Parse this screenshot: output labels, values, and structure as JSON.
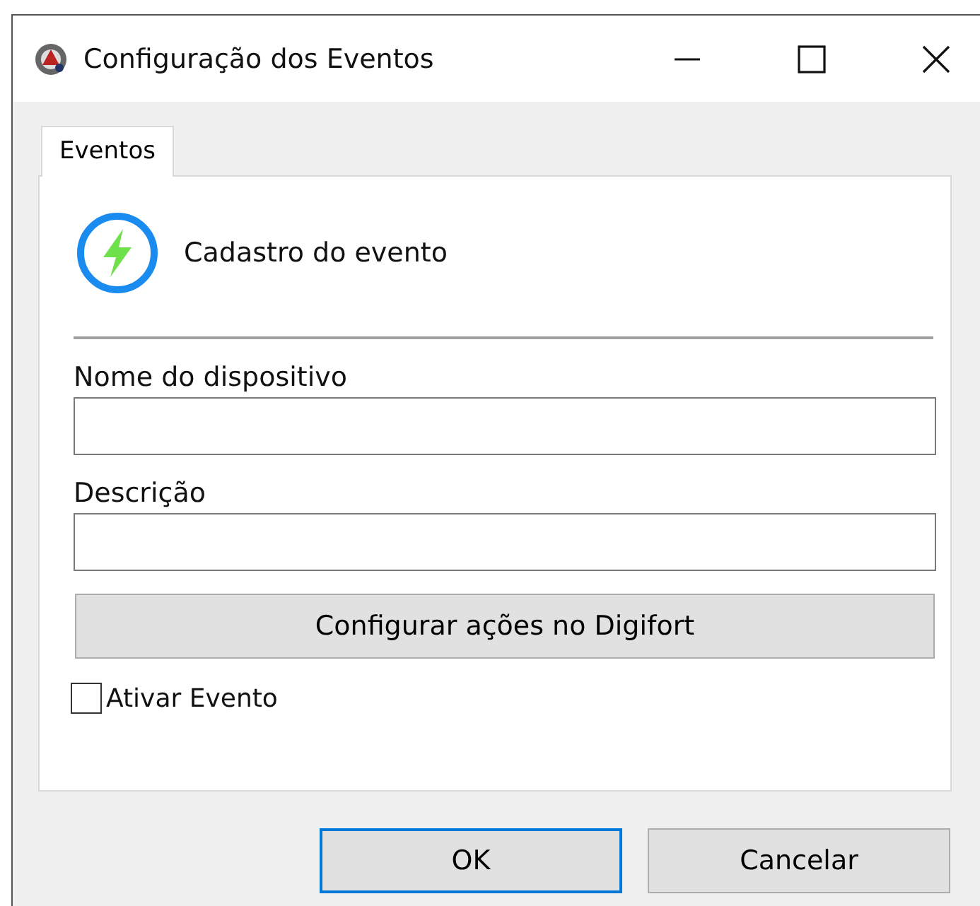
{
  "window": {
    "title": "Configuração dos Eventos"
  },
  "tabs": [
    {
      "label": "Eventos",
      "selected": true
    }
  ],
  "header": {
    "title": "Cadastro do evento"
  },
  "fields": [
    {
      "label": "Nome do dispositivo"
    },
    {
      "label": "Descrição"
    }
  ],
  "action_button": "Configurar ações no Digifort",
  "checkbox": {
    "label": "Ativar Evento",
    "checked": false
  },
  "buttons": [
    {
      "label": "OK",
      "selected": true
    },
    {
      "label": "Cancelar",
      "selected": false
    }
  ]
}
